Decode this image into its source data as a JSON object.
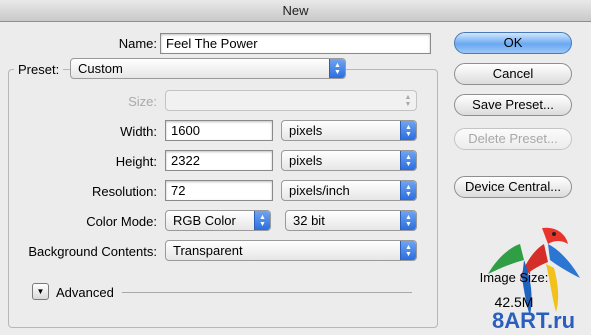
{
  "window": {
    "title": "New"
  },
  "form": {
    "name": {
      "label": "Name:",
      "value": "Feel The Power"
    },
    "preset": {
      "label": "Preset:",
      "value": "Custom"
    },
    "size": {
      "label": "Size:",
      "value": ""
    },
    "width": {
      "label": "Width:",
      "value": "1600",
      "unit": "pixels"
    },
    "height": {
      "label": "Height:",
      "value": "2322",
      "unit": "pixels"
    },
    "resolution": {
      "label": "Resolution:",
      "value": "72",
      "unit": "pixels/inch"
    },
    "color_mode": {
      "label": "Color Mode:",
      "value": "RGB Color",
      "depth": "32 bit"
    },
    "background": {
      "label": "Background Contents:",
      "value": "Transparent"
    },
    "advanced": {
      "label": "Advanced"
    }
  },
  "buttons": {
    "ok": "OK",
    "cancel": "Cancel",
    "save_preset": "Save Preset...",
    "delete_preset": "Delete Preset...",
    "device_central": "Device Central..."
  },
  "image_size": {
    "label": "Image Size:",
    "value": "42.5M"
  },
  "watermark": {
    "text": "8ART.ru"
  },
  "colors": {
    "accent": "#3b7fe6",
    "ok_button": "#6aa9f2"
  }
}
